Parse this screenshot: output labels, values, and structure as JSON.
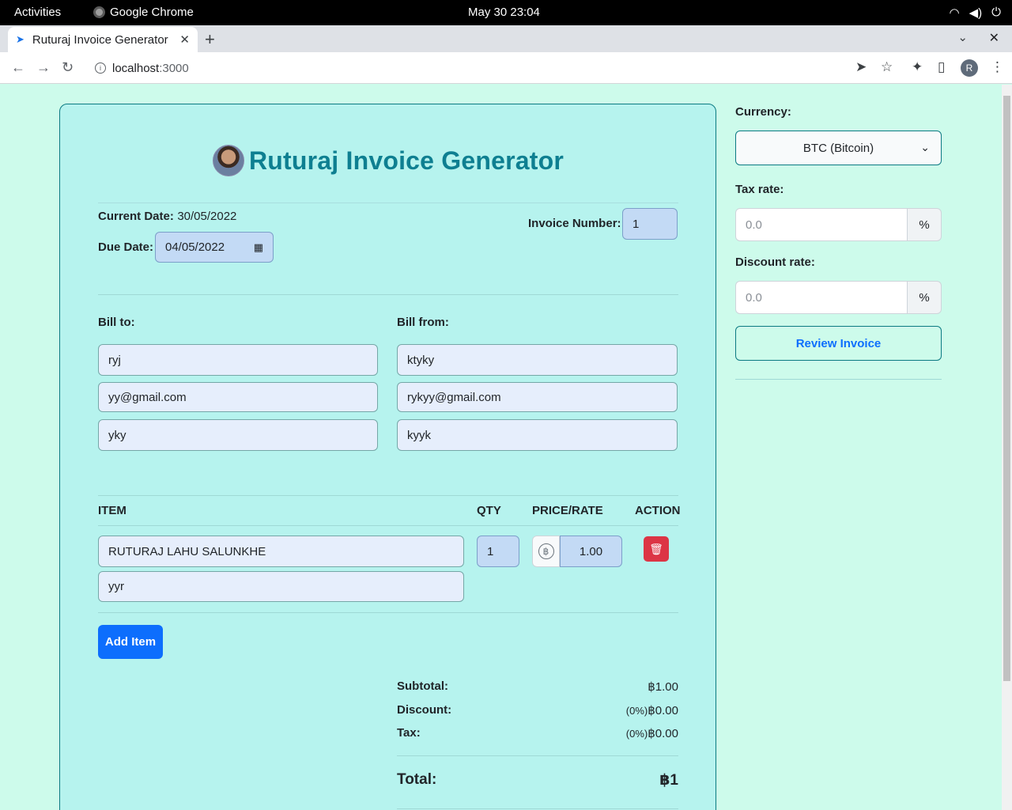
{
  "system": {
    "activities": "Activities",
    "app_name": "Google Chrome",
    "clock": "May 30  23:04"
  },
  "browser": {
    "tab_title": "Ruturaj Invoice Generator",
    "url_host": "localhost",
    "url_port": ":3000",
    "profile_initial": "R"
  },
  "invoice": {
    "title": "Ruturaj Invoice Generator",
    "current_date_label": "Current Date:",
    "current_date": "30/05/2022",
    "due_date_label": "Due Date:",
    "due_date": "04/05/2022",
    "invoice_number_label": "Invoice Number:",
    "invoice_number": "1",
    "bill_to_label": "Bill to:",
    "bill_from_label": "Bill from:",
    "bill_to": {
      "name": "ryj",
      "email": "yy@gmail.com",
      "address": "yky"
    },
    "bill_from": {
      "name": "ktyky",
      "email": "rykyy@gmail.com",
      "address": "kyyk"
    },
    "columns": {
      "item": "ITEM",
      "qty": "QTY",
      "price": "PRICE/RATE",
      "action": "ACTION"
    },
    "items": [
      {
        "name": "RUTURAJ LAHU SALUNKHE",
        "description": "yyr",
        "qty": "1",
        "currency_symbol": "฿",
        "price": "1.00"
      }
    ],
    "add_item_label": "Add Item",
    "summary": {
      "subtotal_label": "Subtotal:",
      "subtotal": "฿1.00",
      "discount_label": "Discount:",
      "discount_pct": "(0%)",
      "discount": "฿0.00",
      "tax_label": "Tax:",
      "tax_pct": "(0%)",
      "tax": "฿0.00",
      "total_label": "Total:",
      "total": "฿1"
    }
  },
  "settings": {
    "currency_label": "Currency:",
    "currency_value": "BTC (Bitcoin)",
    "tax_rate_label": "Tax rate:",
    "tax_rate_placeholder": "0.0",
    "discount_rate_label": "Discount rate:",
    "discount_rate_placeholder": "0.0",
    "percent_symbol": "%",
    "review_label": "Review Invoice"
  }
}
